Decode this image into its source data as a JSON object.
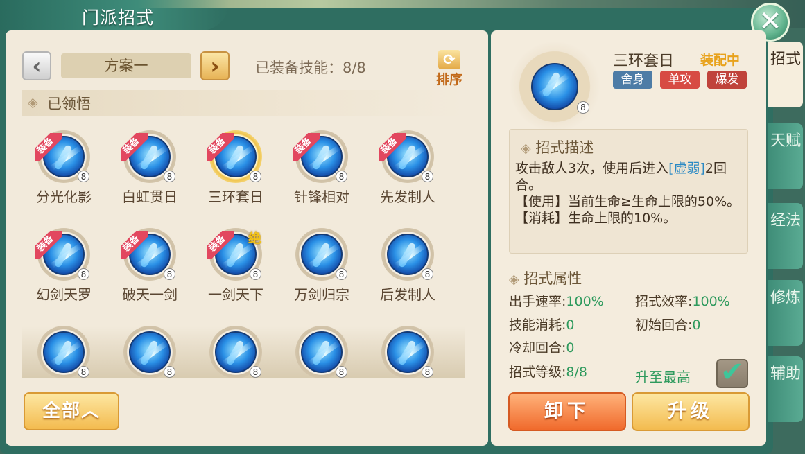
{
  "window": {
    "title": "门派招式",
    "close_label": "✕"
  },
  "plan": {
    "prev_label": "‹",
    "next_label": "›",
    "name": "方案一",
    "equipped_label": "已装备技能：8/8"
  },
  "sort": {
    "icon": "⟳",
    "label": "排序"
  },
  "learned_section": {
    "title": "已领悟"
  },
  "skills": [
    {
      "name": "分光化影",
      "equip_badge": "装备",
      "level": "8"
    },
    {
      "name": "白虹贯日",
      "equip_badge": "装备",
      "level": "8"
    },
    {
      "name": "三环套日",
      "equip_badge": "装备",
      "level": "8"
    },
    {
      "name": "针锋相对",
      "equip_badge": "装备",
      "level": "8"
    },
    {
      "name": "先发制人",
      "equip_badge": "装备",
      "level": "8"
    },
    {
      "name": "幻剑天罗",
      "equip_badge": "装备",
      "level": "8"
    },
    {
      "name": "破天一剑",
      "equip_badge": "装备",
      "level": "8"
    },
    {
      "name": "一剑天下",
      "equip_badge": "装备",
      "level": "8",
      "ultimate": "绝"
    },
    {
      "name": "万剑归宗",
      "equip_badge": "",
      "level": "8"
    },
    {
      "name": "后发制人",
      "equip_badge": "",
      "level": "8"
    },
    {
      "name": "",
      "equip_badge": "",
      "level": "8"
    },
    {
      "name": "",
      "equip_badge": "",
      "level": "8"
    },
    {
      "name": "",
      "equip_badge": "",
      "level": "8"
    },
    {
      "name": "",
      "equip_badge": "",
      "level": "8"
    },
    {
      "name": "",
      "equip_badge": "",
      "level": "8"
    }
  ],
  "filter": {
    "label": "全部︿"
  },
  "detail": {
    "name": "三环套日",
    "status": "装配中",
    "level": "8",
    "tags": [
      "舍身",
      "单攻",
      "爆发"
    ],
    "desc_title": "招式描述",
    "desc_part1": "攻击敌人3次，使用后进入",
    "desc_highlight": "[虚弱]",
    "desc_part2": "2回合。",
    "desc_use": "【使用】当前生命≥生命上限的50%。",
    "desc_cost": "【消耗】生命上限的10%。",
    "attr_title": "招式属性",
    "attrs": [
      {
        "label": "出手速率:",
        "value": "100%"
      },
      {
        "label": "招式效率:",
        "value": "100%"
      },
      {
        "label": "技能消耗:",
        "value": "0"
      },
      {
        "label": "初始回合:",
        "value": "0"
      },
      {
        "label": "冷却回合:",
        "value": "0"
      },
      {
        "label": "招式等级:",
        "value": "8/8"
      }
    ],
    "max_label": "升至最高",
    "check_mark": "✔",
    "unequip_label": "卸下",
    "upgrade_label": "升级"
  },
  "side_tabs": [
    {
      "label": "招式"
    },
    {
      "label": "天赋"
    },
    {
      "label": "经法"
    },
    {
      "label": "修炼"
    },
    {
      "label": "辅助"
    }
  ],
  "colors": {
    "accent_green": "#2e9a5d",
    "equip_red": "#e2475f",
    "highlight_blue": "#2a89c4"
  }
}
